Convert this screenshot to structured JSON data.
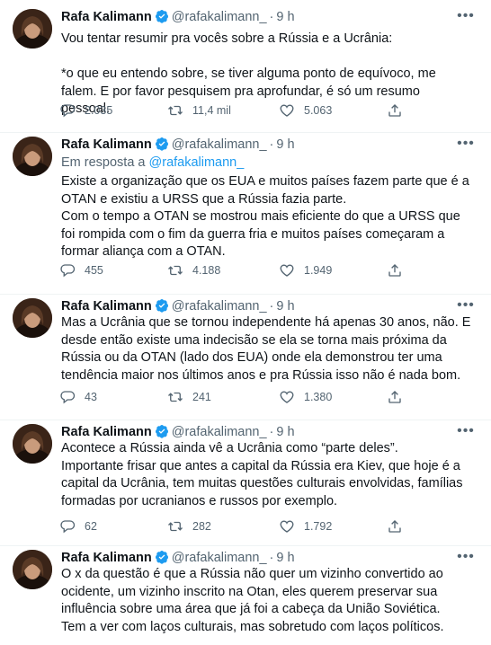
{
  "tweets": [
    {
      "name": "Rafa Kalimann",
      "handle": "@rafakalimann_",
      "dot": "·",
      "time": "9 h",
      "replying_prefix": "",
      "replying_mention": "",
      "text": "Vou tentar resumir pra vocês sobre a Rússia e a Ucrânia:\n\n*o que eu entendo sobre, se tiver alguma ponto de equívoco, me falem. E por favor pesquisem pra aprofundar, é só um resumo pessoal.",
      "replies": "2.035",
      "retweets": "11,4 mil",
      "likes": "5.063"
    },
    {
      "name": "Rafa Kalimann",
      "handle": "@rafakalimann_",
      "dot": "·",
      "time": "9 h",
      "replying_prefix": "Em resposta a ",
      "replying_mention": "@rafakalimann_",
      "text": "Existe a organização que os EUA e muitos países fazem parte que é a OTAN e existiu a URSS que a Rússia fazia parte.\nCom o tempo a OTAN se mostrou mais eficiente do que a URSS que foi rompida com o fim da guerra fria e muitos países começaram a formar aliança com a OTAN.",
      "replies": "455",
      "retweets": "4.188",
      "likes": "1.949"
    },
    {
      "name": "Rafa Kalimann",
      "handle": "@rafakalimann_",
      "dot": "·",
      "time": "9 h",
      "replying_prefix": "",
      "replying_mention": "",
      "text": "Mas a Ucrânia que se tornou independente há apenas 30 anos, não. E desde então existe uma indecisão se ela se torna mais próxima da Rússia ou da OTAN (lado dos EUA) onde ela demonstrou ter uma tendência maior nos últimos anos e pra Rússia isso não é nada bom.",
      "replies": "43",
      "retweets": "241",
      "likes": "1.380"
    },
    {
      "name": "Rafa Kalimann",
      "handle": "@rafakalimann_",
      "dot": "·",
      "time": "9 h",
      "replying_prefix": "",
      "replying_mention": "",
      "text": "Acontece a Rússia ainda vê a Ucrânia como “parte deles”.\nImportante frisar que antes a capital da Rússia era Kiev, que hoje é a capital da Ucrânia, tem muitas questões culturais envolvidas, famílias formadas por ucranianos e russos por exemplo.",
      "replies": "62",
      "retweets": "282",
      "likes": "1.792"
    },
    {
      "name": "Rafa Kalimann",
      "handle": "@rafakalimann_",
      "dot": "·",
      "time": "9 h",
      "replying_prefix": "",
      "replying_mention": "",
      "text": "O x da questão é que a Rússia não quer um vizinho convertido ao ocidente, um vizinho inscrito na Otan, eles querem preservar sua influência sobre uma área que já foi a cabeça da União Soviética.\nTem a ver com laços culturais, mas sobretudo com laços políticos.",
      "replies": "",
      "retweets": "",
      "likes": ""
    }
  ],
  "icons": {
    "more": "more-horizontal-icon",
    "verified": "verified-badge-icon",
    "reply": "reply-icon",
    "retweet": "retweet-icon",
    "like": "heart-icon",
    "share": "share-icon"
  },
  "colors": {
    "accent": "#1d9bf0",
    "muted": "#536471",
    "text": "#0f1419",
    "border": "#eff3f4"
  }
}
